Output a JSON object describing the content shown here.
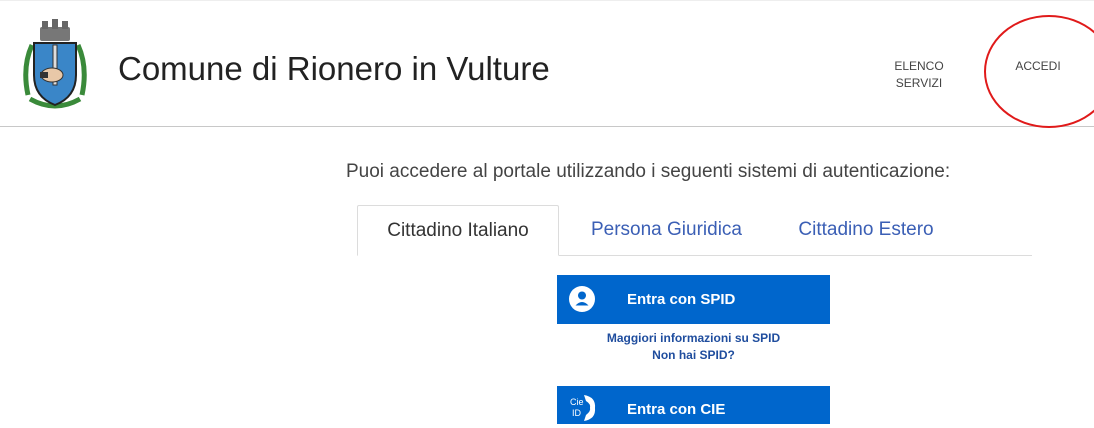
{
  "header": {
    "title": "Comune di Rionero in Vulture",
    "logo_icon": "municipal-coat-of-arms",
    "nav": {
      "elenco_line1": "ELENCO",
      "elenco_line2": "SERVIZI",
      "accedi": "ACCEDI"
    },
    "annotation_color": "#e01a1a"
  },
  "main": {
    "intro": "Puoi accedere al portale utilizzando i seguenti sistemi di autenticazione:",
    "tabs": [
      {
        "label": "Cittadino Italiano",
        "active": true
      },
      {
        "label": "Persona Giuridica",
        "active": false
      },
      {
        "label": "Cittadino Estero",
        "active": false
      }
    ],
    "spid": {
      "button_label": "Entra con SPID",
      "icon": "spid-user-icon",
      "links": [
        "Maggiori informazioni su SPID",
        "Non hai SPID?"
      ]
    },
    "cie": {
      "button_label": "Entra con CIE",
      "icon": "cie-id-icon",
      "icon_text": "Cie ID"
    }
  },
  "colors": {
    "button_blue": "#0066cc",
    "tab_link_blue": "#3b5fb5",
    "link_blue": "#1f4d9e"
  }
}
